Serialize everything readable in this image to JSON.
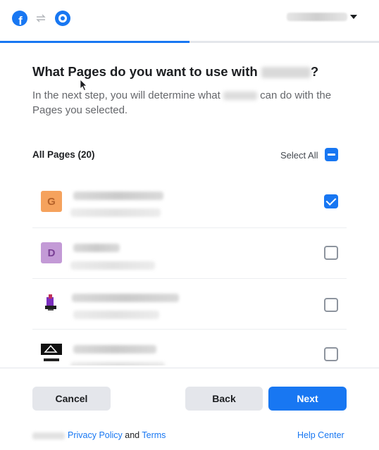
{
  "header": {
    "brand_icon": "facebook-logo-icon",
    "swap_icon": "swap-arrows-icon",
    "app_icon": "app-logo-icon",
    "account_menu_icon": "caret-down-icon"
  },
  "progress": {
    "fraction": 0.5,
    "color": "#1877f2"
  },
  "dialog": {
    "title": "What Pages do you want to use with",
    "title_end": "?",
    "subtitle_start": "In the next step, you will determine what",
    "subtitle_end": "can do with the Pages you selected."
  },
  "list": {
    "header": "All Pages (20)",
    "select_all_label": "Select All",
    "pages": [
      {
        "initial": "G",
        "checked": true
      },
      {
        "initial": "D",
        "checked": false
      },
      {
        "initial": "",
        "checked": false
      },
      {
        "initial": "",
        "checked": false
      }
    ]
  },
  "footer": {
    "cancel": "Cancel",
    "back": "Back",
    "next": "Next",
    "privacy_policy": "Privacy Policy",
    "and": "and",
    "terms": "Terms",
    "help_center": "Help Center"
  },
  "colors": {
    "accent": "#1877f2",
    "avatar_g": "#f5a25d",
    "avatar_d": "#c39ad6"
  }
}
